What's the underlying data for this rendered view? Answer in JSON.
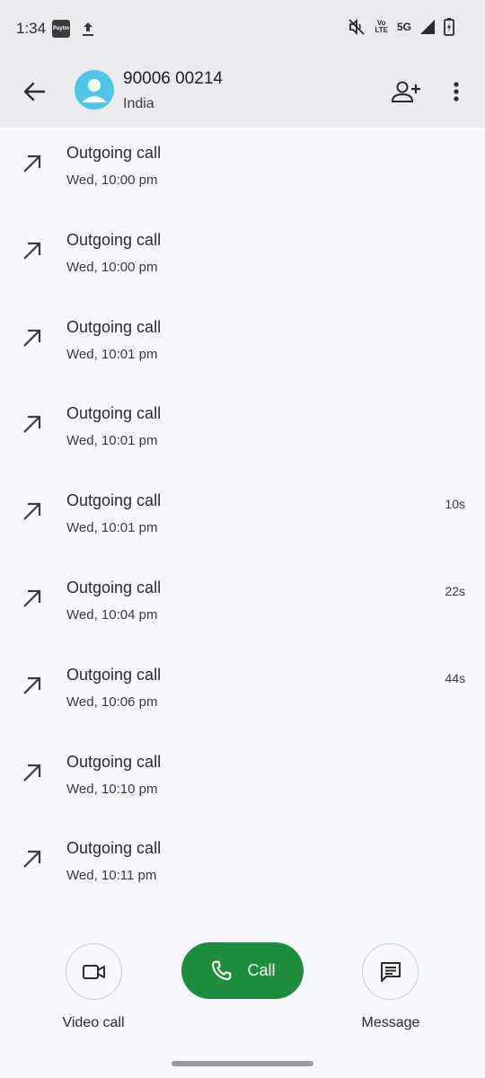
{
  "status_bar": {
    "time": "1:34",
    "paytm_label": "Paytm",
    "volte_line1": "Vo",
    "volte_line2": "LTE",
    "network": "5G"
  },
  "header": {
    "contact_number": "90006 00214",
    "contact_location": "India"
  },
  "calls": [
    {
      "type": "Outgoing call",
      "time": "Wed, 10:00 pm",
      "duration": ""
    },
    {
      "type": "Outgoing call",
      "time": "Wed, 10:00 pm",
      "duration": ""
    },
    {
      "type": "Outgoing call",
      "time": "Wed, 10:01 pm",
      "duration": ""
    },
    {
      "type": "Outgoing call",
      "time": "Wed, 10:01 pm",
      "duration": ""
    },
    {
      "type": "Outgoing call",
      "time": "Wed, 10:01 pm",
      "duration": "10s"
    },
    {
      "type": "Outgoing call",
      "time": "Wed, 10:04 pm",
      "duration": "22s"
    },
    {
      "type": "Outgoing call",
      "time": "Wed, 10:06 pm",
      "duration": "44s"
    },
    {
      "type": "Outgoing call",
      "time": "Wed, 10:10 pm",
      "duration": ""
    },
    {
      "type": "Outgoing call",
      "time": "Wed, 10:11 pm",
      "duration": ""
    }
  ],
  "actions": {
    "video_call_label": "Video call",
    "call_label": "Call",
    "message_label": "Message"
  },
  "colors": {
    "accent_green": "#1e8e3e",
    "avatar_blue": "#4fc6e8",
    "header_bg": "#e9ebee",
    "page_bg": "#f6f8fc"
  }
}
